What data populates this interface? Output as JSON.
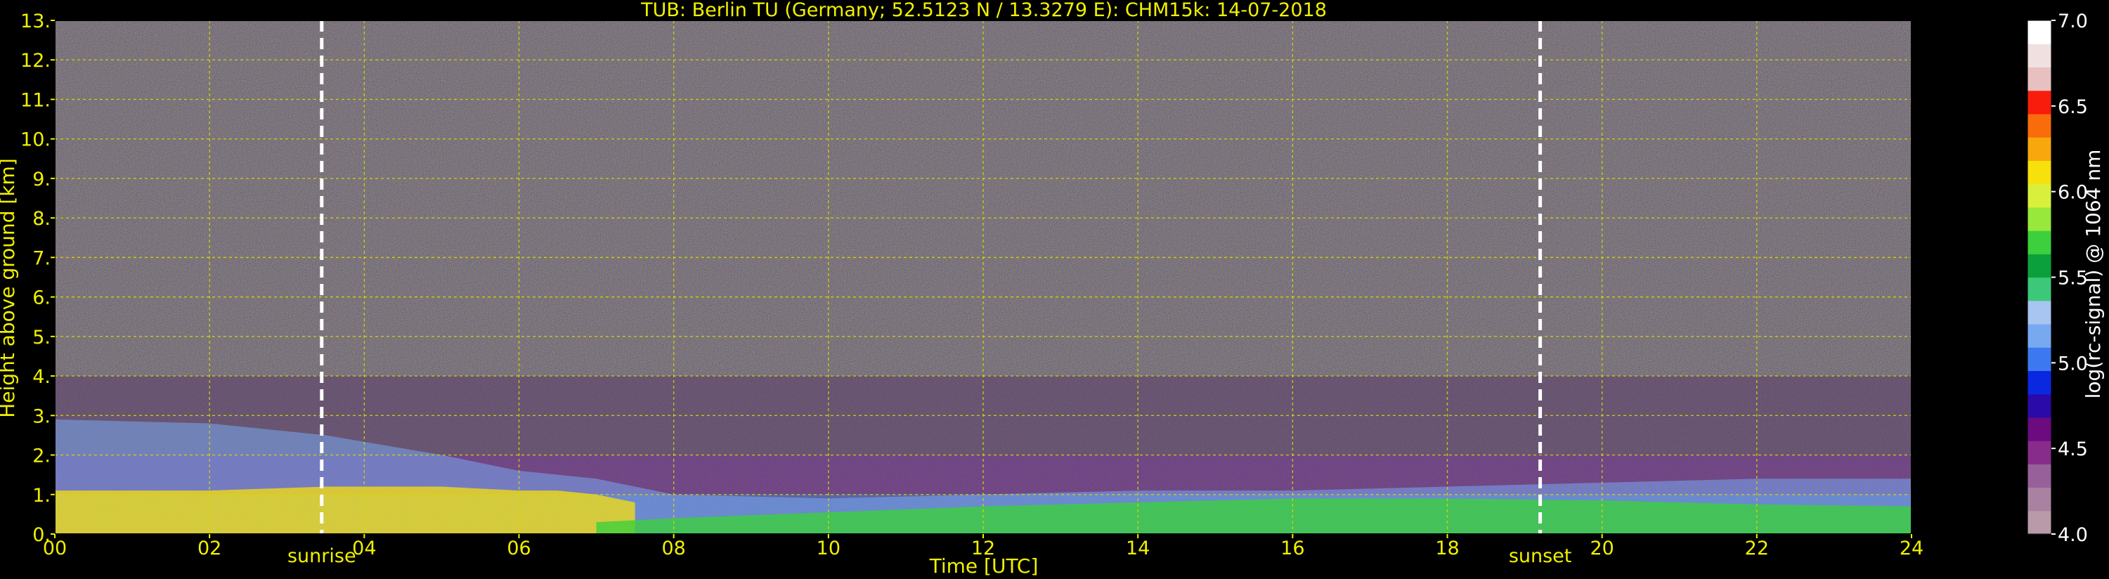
{
  "chart_data": {
    "type": "heatmap",
    "title": "TUB: Berlin TU (Germany; 52.5123 N / 13.3279 E):    CHM15k: 14-07-2018",
    "xlabel": "Time [UTC]",
    "ylabel": "Height above ground [km]",
    "xlim": [
      0,
      24
    ],
    "ylim": [
      0,
      13
    ],
    "x_ticks": [
      0,
      2,
      4,
      6,
      8,
      10,
      12,
      14,
      16,
      18,
      20,
      22,
      24
    ],
    "x_tick_labels": [
      "00",
      "02",
      "04",
      "06",
      "08",
      "10",
      "12",
      "14",
      "16",
      "18",
      "20",
      "22",
      "24"
    ],
    "y_ticks": [
      0,
      1,
      2,
      3,
      4,
      5,
      6,
      7,
      8,
      9,
      10,
      11,
      12,
      13
    ],
    "y_tick_labels": [
      "0.",
      "1.",
      "2.",
      "3.",
      "4.",
      "5.",
      "6.",
      "7.",
      "8.",
      "9.",
      "10.",
      "11.",
      "12.",
      "13."
    ],
    "grid": true,
    "annotations": [
      {
        "text": "sunrise",
        "x": 3.45
      },
      {
        "text": "sunset",
        "x": 19.2
      }
    ],
    "colorbar": {
      "label": "log(rc-signal) @ 1064 nm",
      "range": [
        4.0,
        7.0
      ],
      "ticks": [
        4.0,
        4.5,
        5.0,
        5.5,
        6.0,
        6.5,
        7.0
      ],
      "tick_labels": [
        "4.0",
        "4.5",
        "5.0",
        "5.5",
        "6.0",
        "6.5",
        "7.0"
      ],
      "colors": [
        "#b89aa8",
        "#a882a0",
        "#98609a",
        "#882c8c",
        "#6c0a80",
        "#2a0aa8",
        "#0a28e0",
        "#3c78f0",
        "#78a8f0",
        "#a8c4f0",
        "#3cc878",
        "#0ca03c",
        "#3cd03c",
        "#98e83c",
        "#d8f03c",
        "#f8e00c",
        "#f8a80c",
        "#f86c0c",
        "#f81c0c",
        "#e8c0c0",
        "#f0e0e0",
        "#ffffff"
      ]
    },
    "layers": [
      {
        "name": "mixing-layer-top",
        "times": [
          0,
          2,
          3.5,
          5,
          6,
          7,
          8,
          10,
          12,
          14,
          16,
          18,
          20,
          22,
          24
        ],
        "heights": [
          2.9,
          2.8,
          2.5,
          2.0,
          1.6,
          1.4,
          1.0,
          0.9,
          1.0,
          1.1,
          1.1,
          1.2,
          1.3,
          1.4,
          1.4
        ]
      },
      {
        "name": "aerosol-layer",
        "times": [
          0,
          2,
          3.5,
          5,
          6,
          6.5,
          7,
          7.5
        ],
        "heights": [
          1.1,
          1.1,
          1.2,
          1.2,
          1.1,
          1.1,
          1.0,
          0.8
        ]
      },
      {
        "name": "boundary-layer",
        "times": [
          7,
          8,
          10,
          12,
          14,
          16,
          18,
          20,
          22,
          24
        ],
        "heights": [
          0.3,
          0.4,
          0.55,
          0.7,
          0.8,
          0.9,
          0.9,
          0.85,
          0.75,
          0.7
        ]
      }
    ]
  }
}
